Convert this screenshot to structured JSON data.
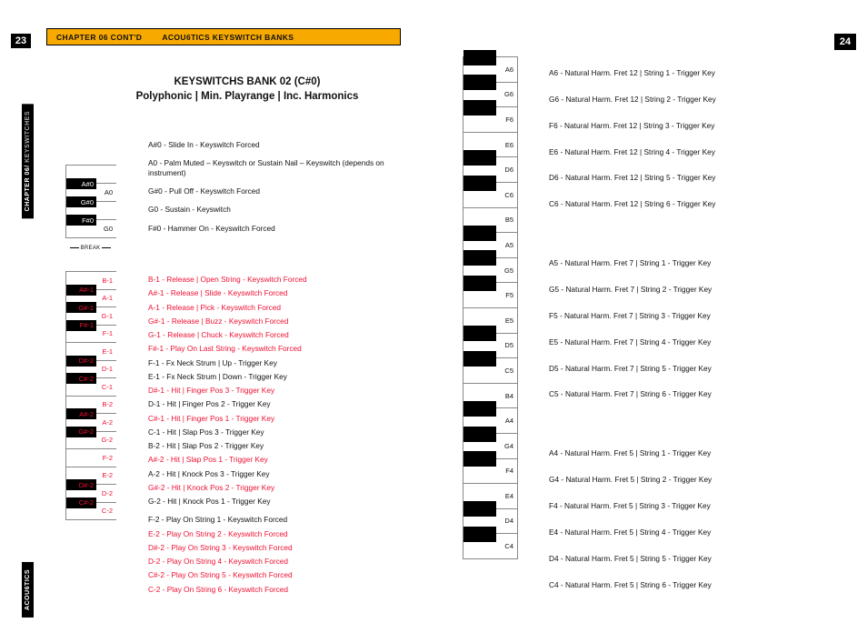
{
  "page_left_num": "23",
  "page_right_num": "24",
  "banner": {
    "left": "CHAPTER 06 CONT'D",
    "right": "ACOU6TICS KEYSWITCH BANKS"
  },
  "side_tab_chapter_a": "CHAPTER 06/",
  "side_tab_chapter_b": " KEYSWITCHES",
  "side_tab_brand": "ACOU6TICS",
  "heading_line1": "KEYSWITCHS BANK 02 (C#0)",
  "heading_line2": "Polyphonic | Min. Playrange | Inc. Harmonics",
  "break_label": "BREAK",
  "kbd1_black": [
    "A#0",
    "G#0",
    "F#0"
  ],
  "kbd1_white": [
    "A0",
    "G0"
  ],
  "kbd2": [
    {
      "t": "w",
      "l": "B-1"
    },
    {
      "t": "b",
      "l": "A#-1"
    },
    {
      "t": "w",
      "l": "A-1"
    },
    {
      "t": "b",
      "l": "G#-1"
    },
    {
      "t": "w",
      "l": "G-1"
    },
    {
      "t": "b",
      "l": "F#-1"
    },
    {
      "t": "w",
      "l": "F-1"
    },
    {
      "t": "w",
      "l": "E-1"
    },
    {
      "t": "b",
      "l": "D#-2"
    },
    {
      "t": "w",
      "l": "D-1"
    },
    {
      "t": "b",
      "l": "C#-2"
    },
    {
      "t": "w",
      "l": "C-1"
    },
    {
      "t": "w",
      "l": "B-2"
    },
    {
      "t": "b",
      "l": "A#-2"
    },
    {
      "t": "w",
      "l": "A-2"
    },
    {
      "t": "b",
      "l": "G#-2"
    },
    {
      "t": "w",
      "l": "G-2"
    },
    {
      "t": "w",
      "l": "F-2"
    },
    {
      "t": "w",
      "l": "E-2"
    },
    {
      "t": "b",
      "l": "D#-2"
    },
    {
      "t": "w",
      "l": "D-2"
    },
    {
      "t": "b",
      "l": "C#-2"
    },
    {
      "t": "w",
      "l": "C-2"
    }
  ],
  "kbd3": [
    "A6",
    "G6",
    "F6",
    "E6",
    "D6",
    "C6",
    "B5",
    "A5",
    "G5",
    "F5",
    "E5",
    "D5",
    "C5",
    "B4",
    "A4",
    "G4",
    "F4",
    "E4",
    "D4",
    "C4"
  ],
  "list1": [
    {
      "txt": "A#0 - Slide In - Keyswitch Forced"
    },
    {
      "txt": "A0 - Palm Muted – Keyswitch or Sustain Nail – Keyswitch (depends on instrument)",
      "multi": true
    },
    {
      "txt": "G#0 - Pull Off - Keyswitch Forced"
    },
    {
      "txt": "G0 - Sustain - Keyswitch"
    },
    {
      "txt": "F#0 - Hammer On - Keyswitch Forced"
    }
  ],
  "list2": [
    {
      "c": "red",
      "t": "B-1 - Release | Open String - Keyswitch Forced"
    },
    {
      "c": "red",
      "t": "A#-1 - Release | Slide - Keyswitch Forced"
    },
    {
      "c": "red",
      "t": "A-1 - Release | Pick - Keyswitch Forced"
    },
    {
      "c": "red",
      "t": "G#-1 - Release | Buzz - Keyswitch Forced"
    },
    {
      "c": "red",
      "t": "G-1 - Release | Chuck - Keyswitch Forced"
    },
    {
      "c": "red",
      "t": "F#-1 - Play On Last String - Keyswitch Forced"
    },
    {
      "c": "",
      "t": "F-1 - Fx Neck Strum | Up - Trigger Key"
    },
    {
      "c": "",
      "t": "E-1 - Fx Neck Strum | Down - Trigger Key"
    },
    {
      "c": "red",
      "t": "D#-1 - Hit | Finger Pos 3 - Trigger Key"
    },
    {
      "c": "",
      "t": "D-1 - Hit | Finger Pos 2 - Trigger Key"
    },
    {
      "c": "red",
      "t": "C#-1 - Hit | Finger Pos 1 - Trigger Key"
    },
    {
      "c": "",
      "t": "C-1 - Hit | Slap Pos 3 - Trigger Key"
    },
    {
      "c": "",
      "t": "B-2 - Hit | Slap Pos 2 - Trigger Key"
    },
    {
      "c": "red",
      "t": "A#-2 - Hit | Slap Pos 1 - Trigger Key"
    },
    {
      "c": "",
      "t": "A-2 - Hit | Knock Pos 3 - Trigger Key"
    },
    {
      "c": "red",
      "t": "G#-2 - Hit | Knock Pos 2 - Trigger Key"
    },
    {
      "c": "",
      "t": "G-2 - Hit | Knock Pos 1 - Trigger Key"
    },
    {
      "spacer": true
    },
    {
      "c": "",
      "t": "F-2 - Play On String 1 - Keyswitch Forced"
    },
    {
      "c": "red",
      "t": "E-2 - Play On String 2 - Keyswitch Forced"
    },
    {
      "c": "red",
      "t": "D#-2 - Play On String 3 - Keyswitch Forced"
    },
    {
      "c": "red",
      "t": "D-2 - Play On String 4 - Keyswitch Forced"
    },
    {
      "c": "red",
      "t": "C#-2 - Play On String 5 - Keyswitch Forced"
    },
    {
      "c": "red",
      "t": "C-2 - Play On String 6 - Keyswitch Forced"
    }
  ],
  "list3": [
    {
      "t": "A6 - Natural Harm. Fret 12 | String 1 - Trigger Key"
    },
    {
      "t": "G6 - Natural Harm. Fret 12 | String 2 - Trigger Key"
    },
    {
      "t": "F6 - Natural Harm. Fret 12 | String 3 - Trigger Key"
    },
    {
      "t": "E6 - Natural Harm. Fret 12 | String 4 - Trigger Key"
    },
    {
      "t": "D6 - Natural Harm. Fret 12 | String 5 - Trigger Key"
    },
    {
      "t": "C6 - Natural Harm. Fret 12 | String 6 - Trigger Key"
    },
    {
      "gap": true
    },
    {
      "t": "A5 - Natural Harm. Fret 7 | String 1 - Trigger Key"
    },
    {
      "t": "G5 - Natural Harm. Fret 7 | String 2 - Trigger Key"
    },
    {
      "t": "F5 - Natural Harm. Fret 7 | String 3 - Trigger Key"
    },
    {
      "t": "E5 - Natural Harm. Fret 7 | String 4 - Trigger Key"
    },
    {
      "t": "D5 - Natural Harm. Fret 7 | String 5 - Trigger Key"
    },
    {
      "t": "C5 - Natural Harm. Fret 7 | String 6 - Trigger Key"
    },
    {
      "gap": true
    },
    {
      "t": "A4 - Natural Harm. Fret 5 | String 1 - Trigger Key"
    },
    {
      "t": "G4 - Natural Harm. Fret 5 | String 2 - Trigger Key"
    },
    {
      "t": "F4 - Natural Harm. Fret 5 | String 3 - Trigger Key"
    },
    {
      "t": "E4 - Natural Harm. Fret 5 | String 4 - Trigger Key"
    },
    {
      "t": "D4 - Natural Harm. Fret 5 | String 5 - Trigger Key"
    },
    {
      "t": "C4 - Natural Harm. Fret 5 | String 6 - Trigger Key"
    }
  ]
}
